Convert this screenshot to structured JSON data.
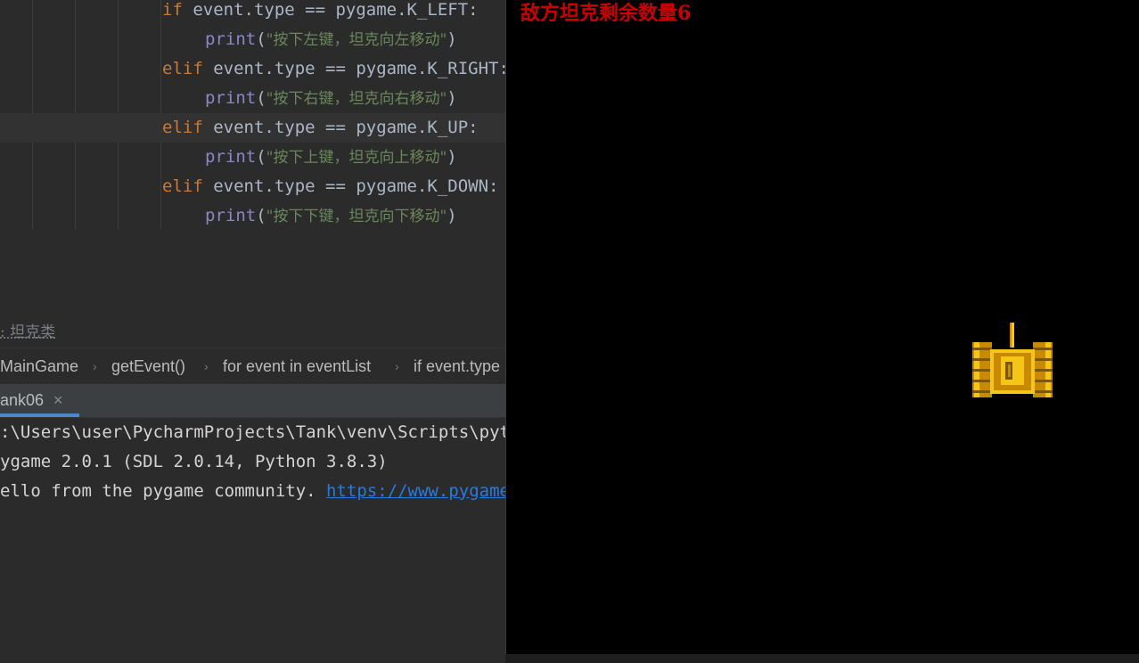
{
  "editor": {
    "lines": [
      {
        "kw": "if",
        "code": " event.type == pygame.K_LEFT:"
      },
      {
        "fn": "print",
        "open": "(",
        "str": "\"按下左键，坦克向左移动\"",
        "close": ")"
      },
      {
        "kw": "elif",
        "code": " event.type == pygame.K_RIGHT:"
      },
      {
        "fn": "print",
        "open": "(",
        "str": "\"按下右键，坦克向右移动\"",
        "close": ")"
      },
      {
        "kw": "elif",
        "code": " event.type == pygame.K_UP:"
      },
      {
        "fn": "print",
        "open": "(",
        "str": "\"按下上键，坦克向上移动\"",
        "close": ")"
      },
      {
        "kw": "elif",
        "code": " event.type == pygame.K_DOWN:"
      },
      {
        "fn": "print",
        "open": "(",
        "str": "\"按下下键，坦克向下移动\"",
        "close": ")"
      }
    ],
    "doc_comment": ": 坦克类"
  },
  "breadcrumb": {
    "items": [
      "MainGame",
      "getEvent()",
      "for event in eventList",
      "if event.type"
    ],
    "separator": "›"
  },
  "run_panel": {
    "tab_label": "ank06",
    "close_glyph": "×"
  },
  "console": {
    "lines": [
      {
        "text": ":\\Users\\user\\PycharmProjects\\Tank\\venv\\Scripts\\python.exe"
      },
      {
        "text": "ygame 2.0.1 (SDL 2.0.14, Python 3.8.3)"
      },
      {
        "text": "ello from the pygame community. ",
        "link": "https://www.pygame.org/contribute.html"
      }
    ]
  },
  "game": {
    "hud_text": "敌方坦克剩余数量6",
    "hud_color": "#cc0000",
    "player_tank": {
      "icon": "tank-sprite-icon",
      "facing": "up",
      "colors": [
        "#f5c518",
        "#c88a00",
        "#7a5a00"
      ]
    }
  },
  "colors": {
    "editor_bg": "#2b2b2b",
    "keyword": "#cc7832",
    "builtin": "#8888c6",
    "string": "#6a8759",
    "link": "#287bde",
    "tab_underline": "#4a88c7",
    "game_bg": "#000000"
  }
}
